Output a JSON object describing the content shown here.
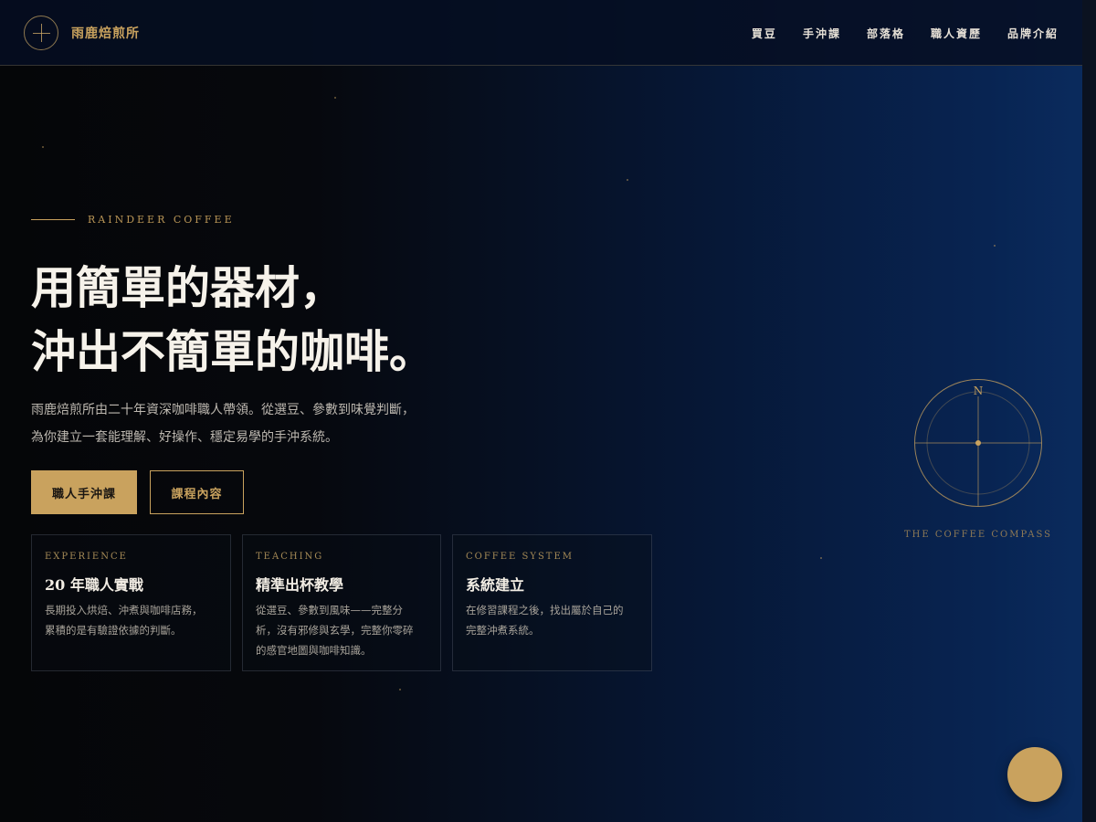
{
  "brand": {
    "name": "雨鹿焙煎所"
  },
  "nav": [
    "買豆",
    "手沖課",
    "部落格",
    "職人資歷",
    "品牌介紹"
  ],
  "hero": {
    "eyebrow": "RAINDEER COFFEE",
    "title_line1": "用簡單的器材，",
    "title_line2": "沖出不簡單的咖啡。",
    "desc_line1": "雨鹿焙煎所由二十年資深咖啡職人帶領。從選豆、參數到味覺判斷，",
    "desc_line2": "為你建立一套能理解、好操作、穩定易學的手沖系統。",
    "primary_button": "職人手沖課",
    "secondary_button": "課程內容"
  },
  "cards": [
    {
      "kicker": "EXPERIENCE",
      "title": "20 年職人實戰",
      "lines": [
        "長期投入烘焙、沖煮與咖啡店務，",
        "累積的是有驗證依據的判斷。"
      ]
    },
    {
      "kicker": "TEACHING",
      "title": "精準出杯教學",
      "lines": [
        "從選豆、參數到風味——完整分",
        "析，沒有邪修與玄學，完整你零碎",
        "的感官地圖與咖啡知識。"
      ]
    },
    {
      "kicker": "COFFEE SYSTEM",
      "title": "系統建立",
      "lines": [
        "在修習課程之後，找出屬於自己的",
        "完整沖煮系統。"
      ]
    }
  ],
  "compass": {
    "north_label": "N",
    "caption": "THE COFFEE COMPASS"
  },
  "colors": {
    "accent": "#c9a25e",
    "background_dark": "#050608",
    "background_blue": "#0a2a5c"
  },
  "icons": {
    "logo": "compass-cross-icon",
    "fab": "gold-circle-button"
  }
}
